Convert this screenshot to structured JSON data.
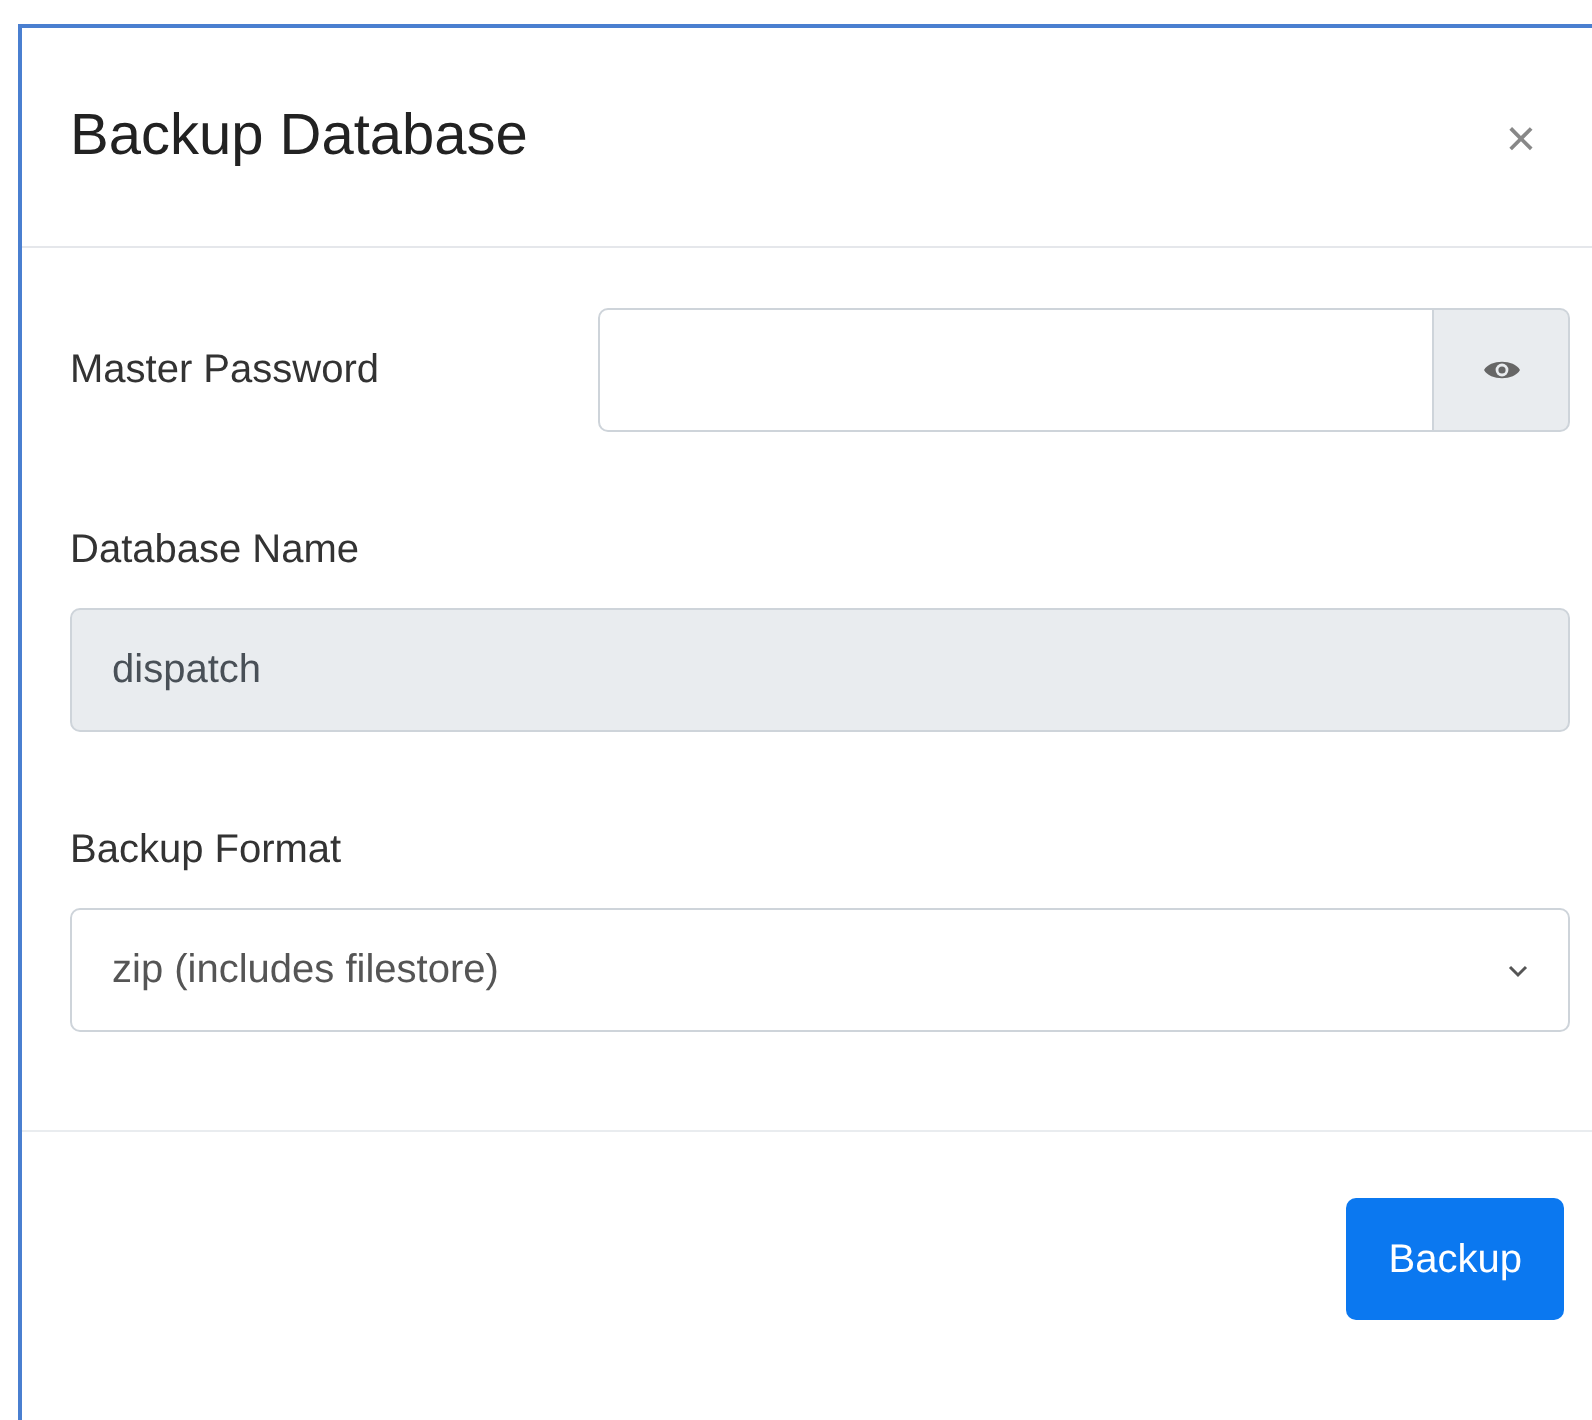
{
  "modal": {
    "title": "Backup Database",
    "close": "×"
  },
  "fields": [
    {
      "kind": "password",
      "label": "Master Password",
      "disabled": false
    },
    {
      "kind": "text",
      "label": "Database Name",
      "value": "dispatch",
      "disabled": true
    },
    {
      "kind": "select",
      "label": "Backup Format",
      "value": "zip (includes filestore)",
      "disabled": false
    }
  ],
  "buttons": [
    {
      "label": "Backup"
    }
  ]
}
